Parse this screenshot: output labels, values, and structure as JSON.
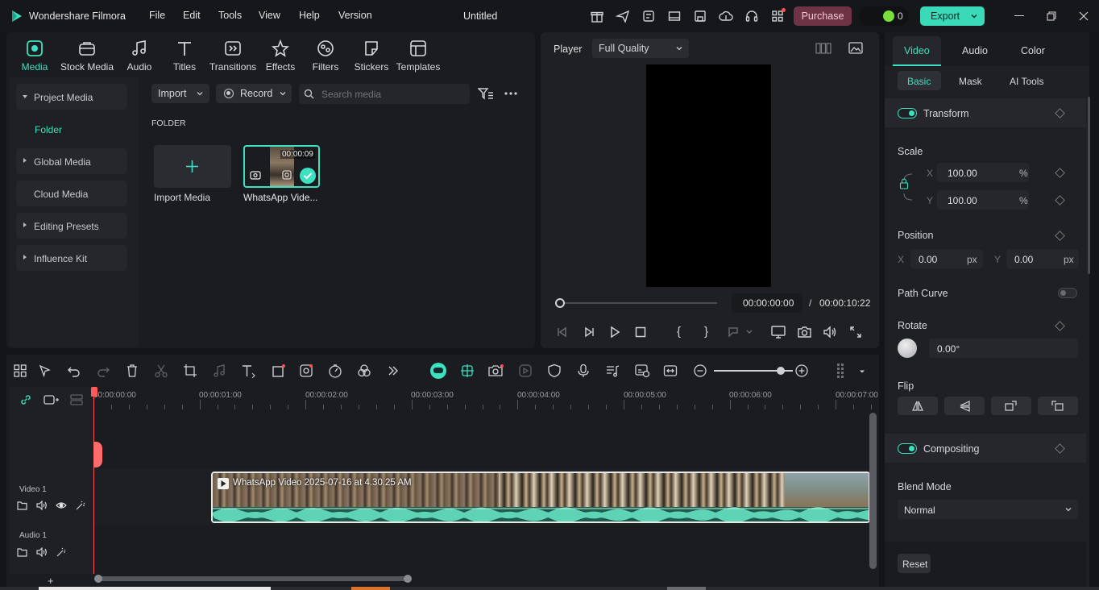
{
  "app": {
    "name": "Wondershare Filmora",
    "doc_title": "Untitled"
  },
  "menu": [
    "File",
    "Edit",
    "Tools",
    "View",
    "Help",
    "Version"
  ],
  "titlebar": {
    "purchase": "Purchase",
    "credits": "0",
    "export": "Export"
  },
  "toolbar": [
    "Media",
    "Stock Media",
    "Audio",
    "Titles",
    "Transitions",
    "Effects",
    "Filters",
    "Stickers",
    "Templates"
  ],
  "sidebar": {
    "items": [
      "Project Media",
      "Folder",
      "Global Media",
      "Cloud Media",
      "Editing Presets",
      "Influence Kit"
    ]
  },
  "media": {
    "import": "Import",
    "record": "Record",
    "search_placeholder": "Search media",
    "folder_label": "FOLDER",
    "import_media": "Import Media",
    "clip_name": "WhatsApp Vide...",
    "clip_duration": "00:00:09"
  },
  "player": {
    "label": "Player",
    "quality": "Full Quality",
    "current_time": "00:00:00:00",
    "separator": "/",
    "total_time": "00:00:10:22"
  },
  "props": {
    "tabs": [
      "Video",
      "Audio",
      "Color"
    ],
    "subtabs": [
      "Basic",
      "Mask",
      "AI Tools"
    ],
    "transform": "Transform",
    "scale": "Scale",
    "scale_x": "100.00",
    "scale_y": "100.00",
    "x_label": "X",
    "y_label": "Y",
    "percent": "%",
    "position": "Position",
    "pos_x": "0.00",
    "pos_y": "0.00",
    "px": "px",
    "path_curve": "Path Curve",
    "rotate": "Rotate",
    "rotate_value": "0.00°",
    "flip": "Flip",
    "compositing": "Compositing",
    "blend_mode": "Blend Mode",
    "blend_value": "Normal",
    "reset": "Reset"
  },
  "timeline": {
    "ruler": [
      "00:00:00:00",
      "00:00:01:00",
      "00:00:02:00",
      "00:00:03:00",
      "00:00:04:00",
      "00:00:05:00",
      "00:00:06:00",
      "00:00:07:00"
    ],
    "video_track": "Video 1",
    "audio_track": "Audio 1",
    "clip_title": "WhatsApp Video 2025-07-16 at 4.30.25 AM",
    "zoom_level": 0.85
  },
  "colors": {
    "accent": "#3de0c0",
    "purchase_bg": "#6e3344",
    "export_bg": "#3ad9b7",
    "playhead": "#ff5a5a"
  }
}
